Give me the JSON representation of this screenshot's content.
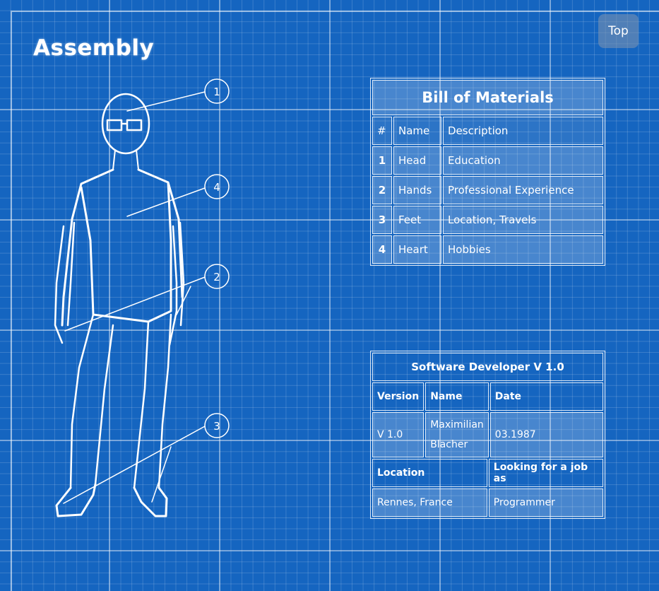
{
  "page": {
    "title": "Assembly"
  },
  "top_button": {
    "label": "Top"
  },
  "figure": {
    "callouts": [
      "1",
      "4",
      "2",
      "3"
    ]
  },
  "bom": {
    "title": "Bill of Materials",
    "headers": {
      "num": "#",
      "name": "Name",
      "description": "Description"
    },
    "rows": [
      {
        "num": "1",
        "name": "Head",
        "description": "Education"
      },
      {
        "num": "2",
        "name": "Hands",
        "description": "Professional Experience"
      },
      {
        "num": "3",
        "name": "Feet",
        "description": "Location, Travels"
      },
      {
        "num": "4",
        "name": "Heart",
        "description": "Hobbies"
      }
    ]
  },
  "spec": {
    "title": "Software Developer V 1.0",
    "version_label": "Version",
    "name_label": "Name",
    "date_label": "Date",
    "version": "V 1.0",
    "name_line1": "Maximilian",
    "name_line2": "Blacher",
    "date": "03.1987",
    "location_label": "Location",
    "job_label": "Looking for a job as",
    "location": "Rennes, France",
    "job": "Programmer"
  },
  "colors": {
    "background": "#1565c0",
    "grid": "#ffffff"
  }
}
